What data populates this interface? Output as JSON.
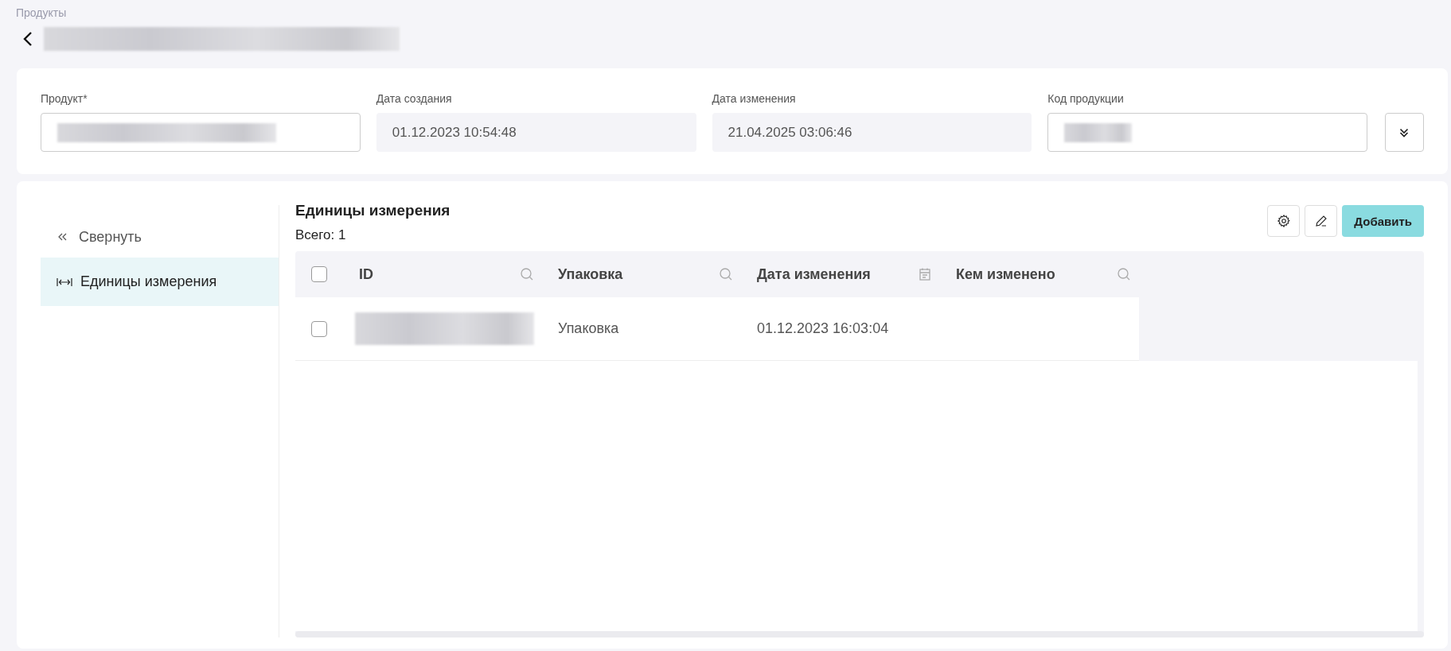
{
  "breadcrumb": "Продукты",
  "form": {
    "fields": [
      {
        "label": "Продукт*",
        "kind": "input"
      },
      {
        "label": "Дата создания",
        "kind": "readonly",
        "value": "01.12.2023 10:54:48"
      },
      {
        "label": "Дата изменения",
        "kind": "readonly",
        "value": "21.04.2025 03:06:46"
      },
      {
        "label": "Код продукции",
        "kind": "input"
      }
    ],
    "expanded": false
  },
  "sidebar": {
    "collapse_label": "Свернуть",
    "items": [
      {
        "label": "Единицы измерения",
        "selected": true
      }
    ]
  },
  "section": {
    "title": "Единицы измерения",
    "total": "Всего: 1",
    "add_button": "Добавить"
  },
  "table": {
    "select_all": false,
    "columns": [
      {
        "label": "ID",
        "kind": "search"
      },
      {
        "label": "Упаковка",
        "kind": "search"
      },
      {
        "label": "Дата изменения",
        "kind": "date"
      },
      {
        "label": "Кем изменено",
        "kind": "search"
      }
    ],
    "rows": [
      {
        "checked": false,
        "cells": [
          {
            "kind": "redacted"
          },
          {
            "kind": "text",
            "text": "Упаковка"
          },
          {
            "kind": "text",
            "text": "01.12.2023 16:03:04"
          }
        ]
      }
    ]
  }
}
